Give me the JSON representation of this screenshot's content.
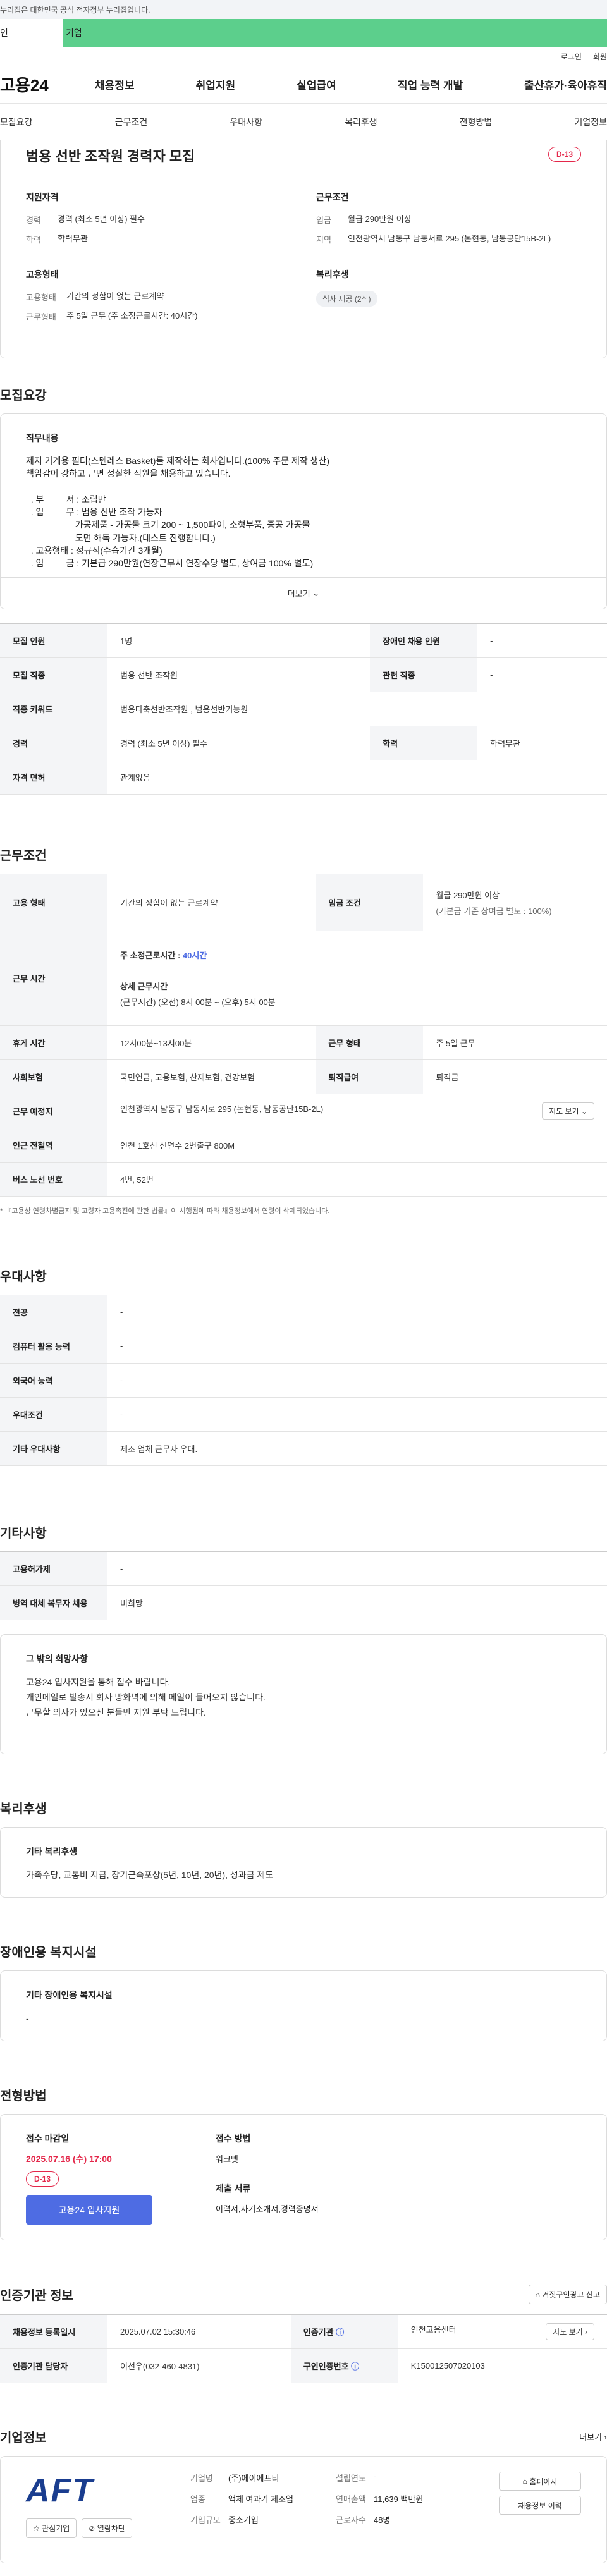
{
  "topbar": {
    "notice": "누리집은 대한민국 공식 전자정부 누리집입니다."
  },
  "top_tabs": [
    "인",
    "기업"
  ],
  "util": {
    "login": "로그인",
    "join": "회원"
  },
  "gnb": {
    "logo": "고용24",
    "menu": [
      "채용정보",
      "취업지원",
      "실업급여",
      "직업 능력 개발",
      "출산휴가·육아휴직"
    ]
  },
  "subtabs": [
    "모집요강",
    "근무조건",
    "우대사항",
    "복리후생",
    "전형방법",
    "기업정보"
  ],
  "summary": {
    "title": "범용 선반 조작원 경력자 모집",
    "dday": "D-13",
    "qual_title": "지원자격",
    "career_k": "경력",
    "career_v": "경력 (최소 5년 이상) 필수",
    "edu_k": "학력",
    "edu_v": "학력무관",
    "emp_title": "고용형태",
    "emptype_k": "고용형태",
    "emptype_v": "기간의 정함이 없는 근로계약",
    "worktype_k": "근무형태",
    "worktype_v": "주 5일 근무 (주 소정근로시간: 40시간)",
    "cond_title": "근무조건",
    "wage_k": "임금",
    "wage_v": "월급 290만원 이상",
    "region_k": "지역",
    "region_v": "인천광역시 남동구 남동서로 295 (논현동, 남동공단15B-2L)",
    "welfare_title": "복리후생",
    "welfare_chip": "식사 제공 (2식)"
  },
  "recruit": {
    "title": "모집요강",
    "job_desc_title": "직무내용",
    "job_desc": "제지 기계용 필터(스텐레스 Basket)를 제작하는 회사입니다.(100% 주문 제작 생산)\n책임감이 강하고 근면 성실한 직원을 채용하고 있습니다.\n\n  . 부         서 : 조립반\n  . 업         무 : 범용 선반 조작 가능자\n                    가공제품 - 가공물 크기 200 ~ 1,500파이, 소형부품, 중공 가공물\n                    도면 해독 가능자.(테스트 진행합니다.)\n  . 고용형태 : 정규직(수습기간 3개월)\n  . 임         금 : 기본급 290만원(연장근무시 연장수당 별도, 상여금 100% 별도)",
    "more": "더보기",
    "rows": [
      [
        "모집 인원",
        "1명",
        "장애인 채용 인원",
        "-"
      ],
      [
        "모집 직종",
        "범용 선반 조작원",
        "관련 직종",
        "-"
      ],
      [
        "직종 키워드",
        "범용다축선반조작원 , 범용선반기능원",
        "",
        ""
      ],
      [
        "경력",
        "경력 (최소 5년 이상) 필수",
        "학력",
        "학력무관"
      ],
      [
        "자격 면허",
        "관계없음",
        "",
        ""
      ]
    ]
  },
  "work": {
    "title": "근무조건",
    "emptype_k": "고용 형태",
    "emptype_v": "기간의 정함이 없는 근로계약",
    "wage_k": "임금 조건",
    "wage_v1": "월급 290만원 이상",
    "wage_v2": "(기본급 기준 상여금 별도 : 100%)",
    "hours_k": "근무 시간",
    "hours_a": "주 소정근로시간 :",
    "hours_a_v": "40시간",
    "hours_b": "상세 근무시간",
    "hours_b_v": "(근무시간) (오전) 8시 00분 ~ (오후) 5시 00분",
    "rest_k": "휴게 시간",
    "rest_v": "12시00분~13시00분",
    "form_k": "근무 형태",
    "form_v": "주 5일 근무",
    "ins_k": "사회보험",
    "ins_v": "국민연금, 고용보험, 산재보험, 건강보험",
    "sev_k": "퇴직급여",
    "sev_v": "퇴직금",
    "place_k": "근무 예정지",
    "place_v": "인천광역시 남동구 남동서로 295 (논현동, 남동공단15B-2L)",
    "map_btn": "지도 보기",
    "subway_k": "인근 전철역",
    "subway_v": "인천 1호선 신연수 2번출구 800M",
    "bus_k": "버스 노선 번호",
    "bus_v": "4번, 52번",
    "note": "* 『고용상 연령차별금지 및 고령자 고용촉진에 관한 법률』이 시행됨에 따라 채용정보에서 연령이 삭제되었습니다."
  },
  "pref": {
    "title": "우대사항",
    "rows": [
      [
        "전공",
        "-"
      ],
      [
        "컴퓨터 활용 능력",
        "-"
      ],
      [
        "외국어 능력",
        "-"
      ],
      [
        "우대조건",
        "-"
      ],
      [
        "기타 우대사항",
        "제조 업체 근무자 우대."
      ]
    ]
  },
  "etc": {
    "title": "기타사항",
    "rows": [
      [
        "고용허가제",
        "-"
      ],
      [
        "병역 대체 복무자 채용",
        "비희망"
      ]
    ],
    "msg_title": "그 밖의 희망사항",
    "msg": [
      "고용24 입사지원을 통해 접수 바랍니다.",
      "개인메일로 발송시 회사 방화벽에 의해 메일이 들어오지 않습니다.",
      "근무할 의사가 있으신 분들만 지원 부탁 드립니다."
    ]
  },
  "welfare": {
    "title": "복리후생",
    "sub": "기타 복리후생",
    "text": "가족수당, 교통비 지급, 장기근속포상(5년, 10년, 20년), 성과급 제도"
  },
  "disabled": {
    "title": "장애인용 복지시설",
    "sub": "기타 장애인용 복지시설",
    "text": "-"
  },
  "process": {
    "title": "전형방법",
    "deadline_k": "접수 마감일",
    "deadline_v": "2025.07.16 (수) 17:00",
    "dday": "D-13",
    "apply_btn": "고용24 입사지원",
    "method_k": "접수 방법",
    "method_v": "워크넷",
    "docs_k": "제출 서류",
    "docs_v": "이력서,자기소개서,경력증명서"
  },
  "cert": {
    "title": "인증기관 정보",
    "report_btn": "거짓구인광고 신고",
    "reg_k": "채용정보 등록일시",
    "reg_v": "2025.07.02 15:30:46",
    "org_k": "인증기관",
    "org_v": "인천고용센터",
    "map_btn": "지도 보기",
    "mgr_k": "인증기관 담당자",
    "mgr_v": "이선우(032-460-4831)",
    "num_k": "구인인증번호",
    "num_v": "K150012507020103"
  },
  "company": {
    "title": "기업정보",
    "more": "더보기",
    "logo": "AFT",
    "fav_btn": "관심기업",
    "block_btn": "열람차단",
    "name_k": "기업명",
    "name_v": "(주)에이에프티",
    "ind_k": "업종",
    "ind_v": "액체 여과기 제조업",
    "size_k": "기업규모",
    "size_v": "중소기업",
    "est_k": "설립연도",
    "est_v": "-",
    "rev_k": "연매출액",
    "rev_v": "11,639 백만원",
    "emp_k": "근로자수",
    "emp_v": "48명",
    "home_btn": "홈페이지",
    "jobs_btn": "채용정보 이력"
  },
  "colors": {
    "accent": "#4e6ce3",
    "dday": "#e4274a",
    "tab_green": "#5ccf8c"
  }
}
